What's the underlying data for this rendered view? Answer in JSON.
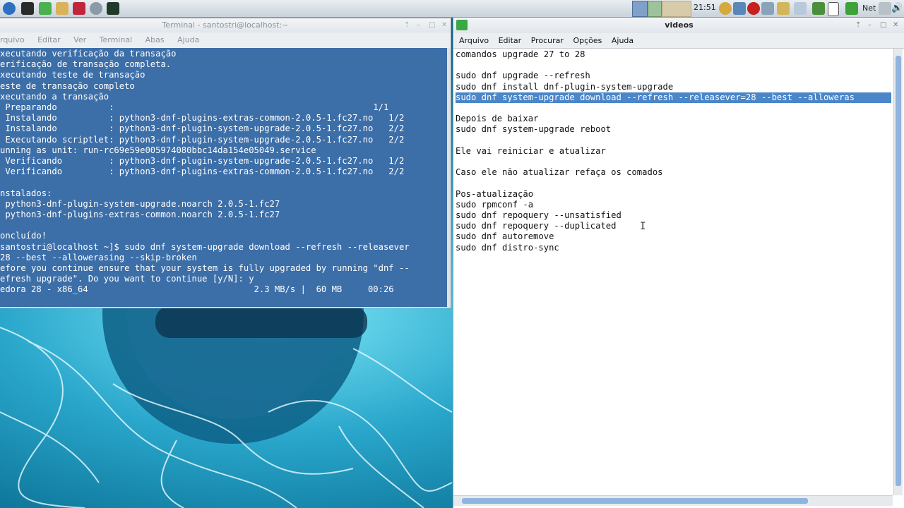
{
  "panel": {
    "clock": "21:51",
    "net_label": "Net"
  },
  "terminal": {
    "title": "Terminal - santostri@localhost:~",
    "menu": [
      "rquivo",
      "Editar",
      "Ver",
      "Terminal",
      "Abas",
      "Ajuda"
    ],
    "lines": [
      "xecutando verificação da transação",
      "erificação de transação completa.",
      "xecutando teste de transação",
      "este de transação completo",
      "xecutando a transação",
      " Preparando          :                                                  1/1",
      " Instalando          : python3-dnf-plugins-extras-common-2.0.5-1.fc27.no   1/2",
      " Instalando          : python3-dnf-plugin-system-upgrade-2.0.5-1.fc27.no   2/2",
      " Executando scriptlet: python3-dnf-plugin-system-upgrade-2.0.5-1.fc27.no   2/2",
      "unning as unit: run-rc69e59e005974080bbc14da154e05049.service",
      " Verificando         : python3-dnf-plugin-system-upgrade-2.0.5-1.fc27.no   1/2",
      " Verificando         : python3-dnf-plugins-extras-common-2.0.5-1.fc27.no   2/2",
      "",
      "nstalados:",
      " python3-dnf-plugin-system-upgrade.noarch 2.0.5-1.fc27",
      " python3-dnf-plugins-extras-common.noarch 2.0.5-1.fc27",
      "",
      "oncluído!",
      "santostri@localhost ~]$ sudo dnf system-upgrade download --refresh --releasever",
      "28 --best --allowerasing --skip-broken",
      "efore you continue ensure that your system is fully upgraded by running \"dnf --",
      "efresh upgrade\". Do you want to continue [y/N]: y",
      "edora 28 - x86_64                                2.3 MB/s |  60 MB     00:26"
    ]
  },
  "editor": {
    "title": "videos",
    "menu": [
      {
        "label": "Arquivo"
      },
      {
        "label": "Editar"
      },
      {
        "label": "Procurar"
      },
      {
        "label": "Opções"
      },
      {
        "label": "Ajuda"
      }
    ],
    "lines": [
      "comandos upgrade 27 to 28",
      "",
      "sudo dnf upgrade --refresh",
      "sudo dnf install dnf-plugin-system-upgrade",
      "sudo dnf system-upgrade download --refresh --releasever=28 --best --alloweras",
      "",
      "Depois de baixar",
      "sudo dnf system-upgrade reboot",
      "",
      "Ele vai reiniciar e atualizar",
      "",
      "Caso ele não atualizar refaça os comados",
      "",
      "Pos-atualização",
      "sudo rpmconf -a",
      "sudo dnf repoquery --unsatisfied",
      "sudo dnf repoquery --duplicated",
      "sudo dnf autoremove",
      "sudo dnf distro-sync"
    ],
    "selected_line_index": 4
  },
  "colors": {
    "terminal_bg": "#3c6ea8",
    "selection": "#4a86c8"
  }
}
